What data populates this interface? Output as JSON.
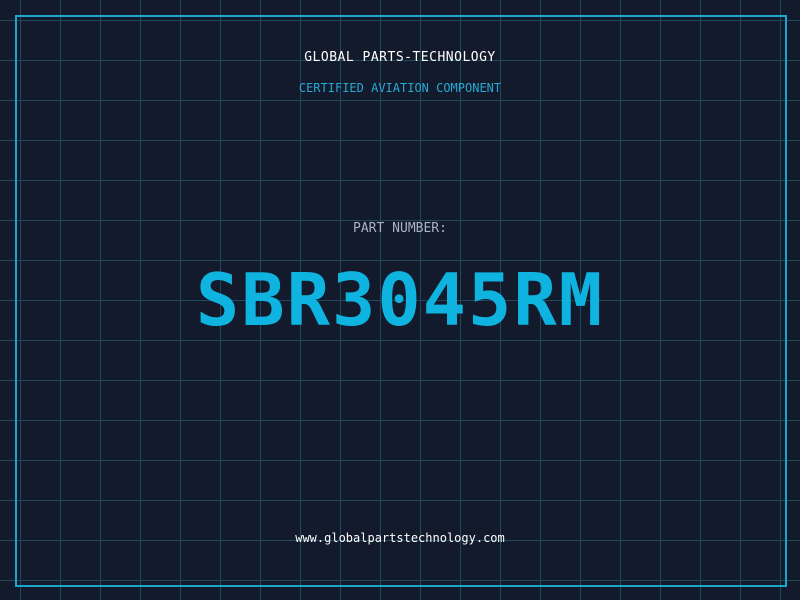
{
  "brand": {
    "name": "GLOBAL PARTS-TECHNOLOGY",
    "tagline": "CERTIFIED AVIATION COMPONENT"
  },
  "part": {
    "label": "PART NUMBER:",
    "number": "SBR3045RM"
  },
  "footer": {
    "website": "www.globalpartstechnology.com"
  },
  "colors": {
    "background": "#121a2c",
    "grid": "#1f4a5e",
    "accent": "#0fb3e0",
    "frame": "#1da6cc",
    "label": "#a9b2c2",
    "text": "#ffffff"
  }
}
